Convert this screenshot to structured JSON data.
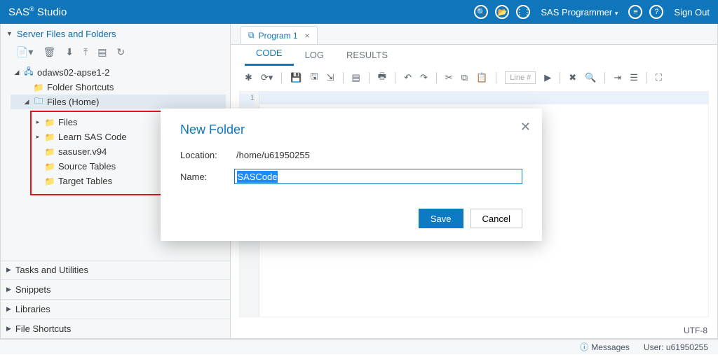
{
  "app": {
    "title_prefix": "SAS",
    "title_suffix": " Studio"
  },
  "topbar": {
    "role": "SAS Programmer",
    "signout": "Sign Out"
  },
  "sidebar": {
    "panel_title": "Server Files and Folders",
    "server": "odaws02-apse1-2",
    "folder_shortcuts": "Folder Shortcuts",
    "files_home": "Files (Home)",
    "items": [
      {
        "label": "Files",
        "expandable": true
      },
      {
        "label": "Learn SAS Code",
        "expandable": true
      },
      {
        "label": "sasuser.v94",
        "expandable": false
      },
      {
        "label": "Source Tables",
        "expandable": false
      },
      {
        "label": "Target Tables",
        "expandable": false
      }
    ],
    "other_panels": [
      "Tasks and Utilities",
      "Snippets",
      "Libraries",
      "File Shortcuts"
    ]
  },
  "editor": {
    "tab": "Program 1",
    "subtabs": {
      "code": "CODE",
      "log": "LOG",
      "results": "RESULTS"
    },
    "line_placeholder": "Line #",
    "gutter_first": "1",
    "encoding": "UTF-8"
  },
  "status": {
    "messages": "Messages",
    "user": "User: u61950255"
  },
  "modal": {
    "title": "New Folder",
    "location_label": "Location:",
    "location": "/home/u61950255",
    "name_label": "Name:",
    "name_value": "SASCode",
    "save": "Save",
    "cancel": "Cancel"
  }
}
